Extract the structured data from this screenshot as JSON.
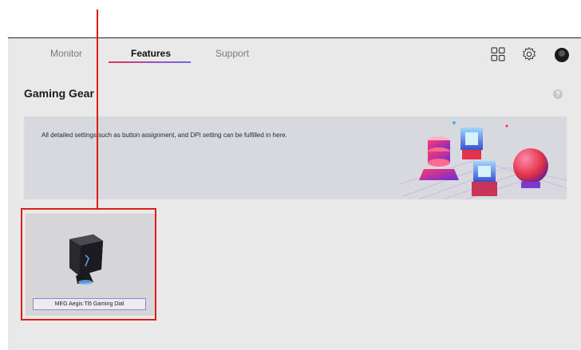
{
  "tabs": [
    {
      "label": "Monitor",
      "active": false
    },
    {
      "label": "Features",
      "active": true
    },
    {
      "label": "Support",
      "active": false
    }
  ],
  "toolbar_icons": [
    "grid-icon",
    "gear-icon",
    "avatar"
  ],
  "page": {
    "title": "Gaming Gear",
    "help_glyph": "?"
  },
  "banner": {
    "text": "All detailed settings such as button assignment, and DPI setting can be fulfilled in here."
  },
  "devices": [
    {
      "label": "MEG Aegis Ti5 Gaming Dial"
    }
  ],
  "colors": {
    "accent_start": "#e2334a",
    "accent_end": "#6a6ae6",
    "annotation": "#e01b1b",
    "panel_bg": "#e9e9ea"
  }
}
